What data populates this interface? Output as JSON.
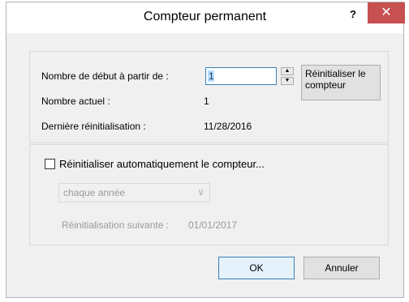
{
  "window": {
    "title": "Compteur permanent",
    "help_label": "?",
    "close_label": "✕"
  },
  "counter": {
    "start_label": "Nombre de début à partir de :",
    "start_value": "1",
    "current_label": "Nombre actuel :",
    "current_value": "1",
    "last_reset_label": "Dernière réinitialisation :",
    "last_reset_value": "11/28/2016",
    "reset_button_label": "Réinitialiser le compteur",
    "spin_up": "▲",
    "spin_down": "▼"
  },
  "auto_reset": {
    "checkbox_label": "Réinitialiser automatiquement le compteur...",
    "checked": false,
    "frequency_value": "chaque année",
    "frequency_chevron": "∨",
    "next_reset_label": "Réinitialisation suivante :",
    "next_reset_value": "01/01/2017"
  },
  "footer": {
    "ok_label": "OK",
    "cancel_label": "Annuler"
  },
  "colors": {
    "close_button": "#c75050",
    "focus_border": "#3c7fb1",
    "dialog_bg": "#f0f0f0"
  }
}
